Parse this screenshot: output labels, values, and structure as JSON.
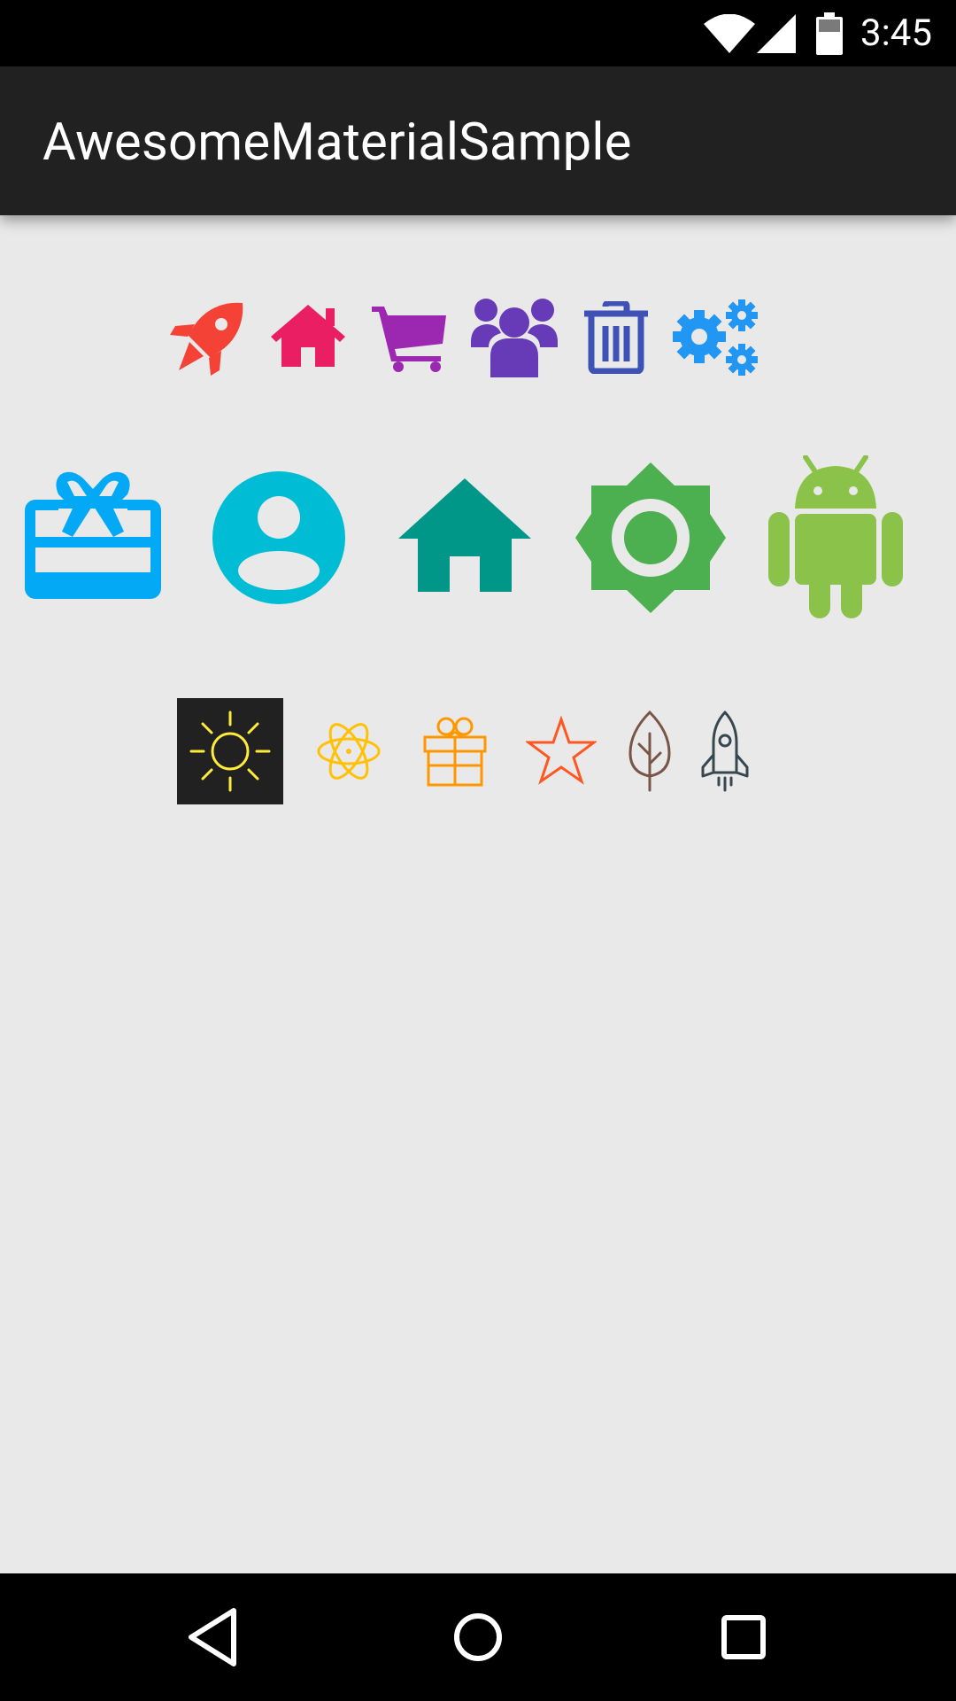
{
  "status_bar": {
    "time": "3:45",
    "icons": [
      "wifi-icon",
      "cell-signal-icon",
      "battery-icon"
    ]
  },
  "app_bar": {
    "title": "AwesomeMaterialSample"
  },
  "icon_rows": [
    {
      "set": "font-awesome",
      "icons": [
        {
          "name": "rocket-icon",
          "color": "#f44336"
        },
        {
          "name": "home-icon",
          "color": "#e91e63"
        },
        {
          "name": "shopping-cart-icon",
          "color": "#9c27b0"
        },
        {
          "name": "users-icon",
          "color": "#673ab7"
        },
        {
          "name": "trash-icon",
          "color": "#3f51b5"
        },
        {
          "name": "cogs-icon",
          "color": "#2196f3"
        }
      ]
    },
    {
      "set": "material",
      "icons": [
        {
          "name": "card-giftcard-icon",
          "color": "#03a9f4"
        },
        {
          "name": "account-circle-icon",
          "color": "#00bcd4"
        },
        {
          "name": "home-icon",
          "color": "#009688"
        },
        {
          "name": "brightness-icon",
          "color": "#4caf50"
        },
        {
          "name": "android-icon",
          "color": "#8bc34a"
        }
      ]
    },
    {
      "set": "line",
      "icons": [
        {
          "name": "sun-icon",
          "color": "#ffeb3b",
          "background": "#212121"
        },
        {
          "name": "atom-icon",
          "color": "#ffc107"
        },
        {
          "name": "gift-icon",
          "color": "#ff9800"
        },
        {
          "name": "star-icon",
          "color": "#ff5722"
        },
        {
          "name": "leaf-icon",
          "color": "#795548"
        },
        {
          "name": "rocket-icon",
          "color": "#37474f"
        }
      ]
    }
  ],
  "nav_bar": {
    "buttons": [
      "back-icon",
      "home-circle-icon",
      "recents-icon"
    ]
  }
}
